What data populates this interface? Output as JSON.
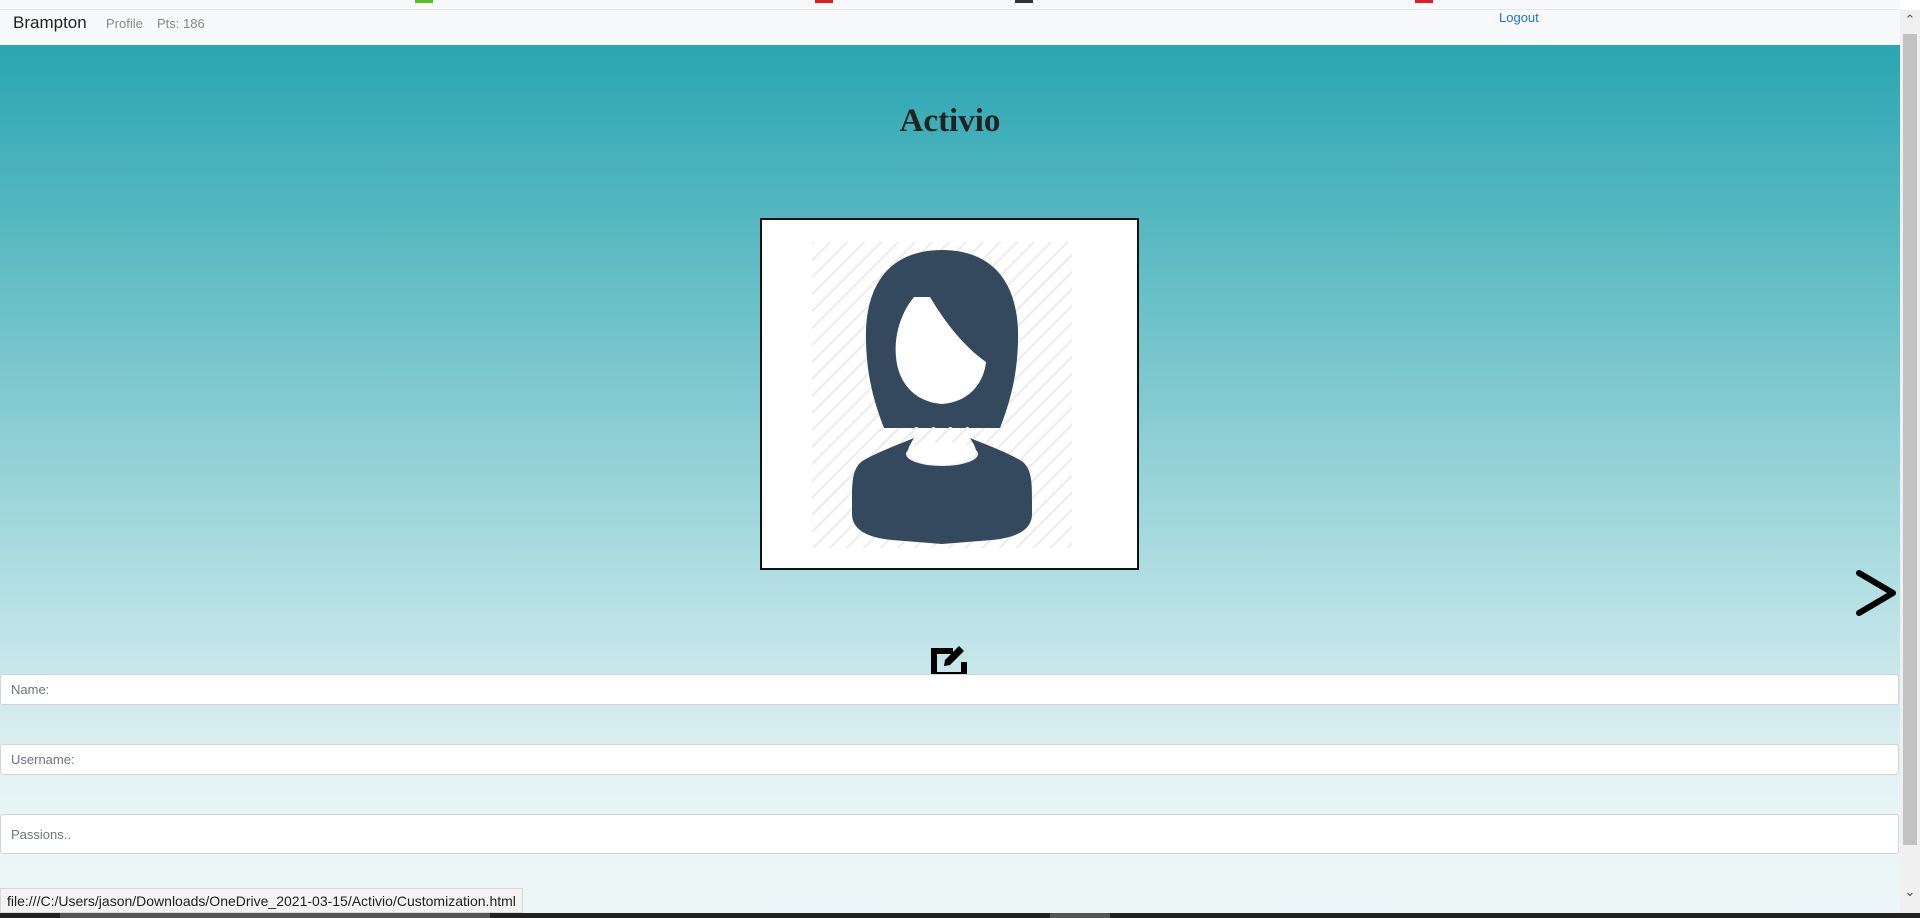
{
  "navbar": {
    "brand": "Brampton",
    "profile_label": "Profile",
    "points_label": "Pts: 186",
    "logout_label": "Logout"
  },
  "main": {
    "title": "Activio",
    "avatar_alt": "avatar-female-silhouette",
    "edit_icon": "edit-icon",
    "next_icon": "chevron-right-icon"
  },
  "form": {
    "name_placeholder": "Name:",
    "username_placeholder": "Username:",
    "passions_placeholder": "Passions.."
  },
  "status_bar": {
    "url": "file:///C:/Users/jason/Downloads/OneDrive_2021-03-15/Activio/Customization.html"
  },
  "colors": {
    "gradient_top": "#2aa6b2",
    "gradient_bottom": "#eef7f8",
    "avatar_fill": "#34495e",
    "logout_link": "#1a73d9"
  }
}
